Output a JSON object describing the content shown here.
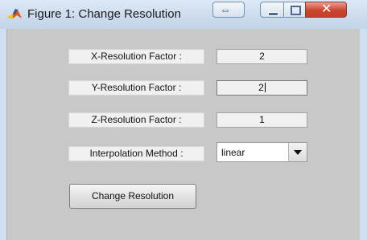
{
  "window": {
    "title": "Figure 1: Change Resolution",
    "icons": [
      "matlab-figure-icon",
      "dock-icon",
      "minimize-icon",
      "maximize-icon",
      "close-icon"
    ]
  },
  "form": {
    "x_label": "X-Resolution Factor :",
    "x_value": "2",
    "y_label": "Y-Resolution Factor :",
    "y_value": "2",
    "z_label": "Z-Resolution Factor :",
    "z_value": "1",
    "interp_label": "Interpolation Method :",
    "interp_value": "linear",
    "submit_label": "Change Resolution"
  },
  "colors": {
    "panel_bg": "#c8c8c8",
    "title_bar": "#cddcee",
    "close_button": "#c9452f"
  }
}
